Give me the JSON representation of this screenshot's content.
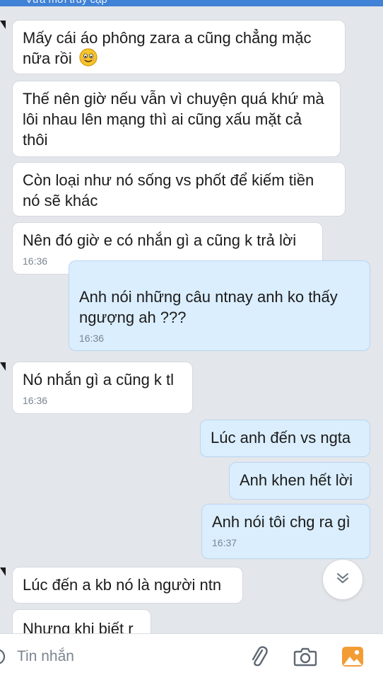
{
  "header": {
    "status": "Vừa mới truy cập"
  },
  "messages": [
    {
      "dir": "in",
      "text": "Mấy cái áo phông zara a cũng chẳng mặc nữa rồi",
      "time": ""
    },
    {
      "dir": "in",
      "text": "Thế nên giờ nếu vẫn vì chuyện quá khứ mà lôi nhau lên mạng thì ai cũng xấu mặt cả thôi",
      "time": ""
    },
    {
      "dir": "in",
      "text": "Còn loại như nó sống vs phốt để kiếm tiền nó sẽ khác",
      "time": ""
    },
    {
      "dir": "in",
      "text": "Nên đó giờ e có nhắn gì a cũng k trả lời",
      "time": "16:36"
    },
    {
      "dir": "out",
      "text": "Anh nói những câu ntnay anh ko thấy ngượng ah ???",
      "time": "16:36"
    },
    {
      "dir": "in",
      "text": "Nó nhắn gì a cũng k tl",
      "time": "16:36"
    },
    {
      "dir": "out",
      "text": "Lúc anh đến vs ngta",
      "time": ""
    },
    {
      "dir": "out",
      "text": "Anh khen hết lời",
      "time": ""
    },
    {
      "dir": "out",
      "text": "Anh nói tôi chg ra gì",
      "time": "16:37"
    },
    {
      "dir": "in",
      "text": "Lúc đến a kb nó là người ntn",
      "time": ""
    },
    {
      "dir": "in",
      "text": "Nhưng khi biết r",
      "time": ""
    }
  ],
  "composer": {
    "placeholder": "Tin nhắn"
  },
  "icons": {
    "smile": "smile-emoji-icon",
    "scroll_down": "double-chevron-down-icon",
    "emoji": "emoji-icon",
    "attach": "paperclip-icon",
    "camera": "camera-icon",
    "gallery": "gallery-icon"
  },
  "colors": {
    "background": "#e3e6ea",
    "incoming_bubble": "#ffffff",
    "outgoing_bubble": "#dbeefe",
    "header": "#3f82d6",
    "gallery_icon": "#f39c34"
  }
}
